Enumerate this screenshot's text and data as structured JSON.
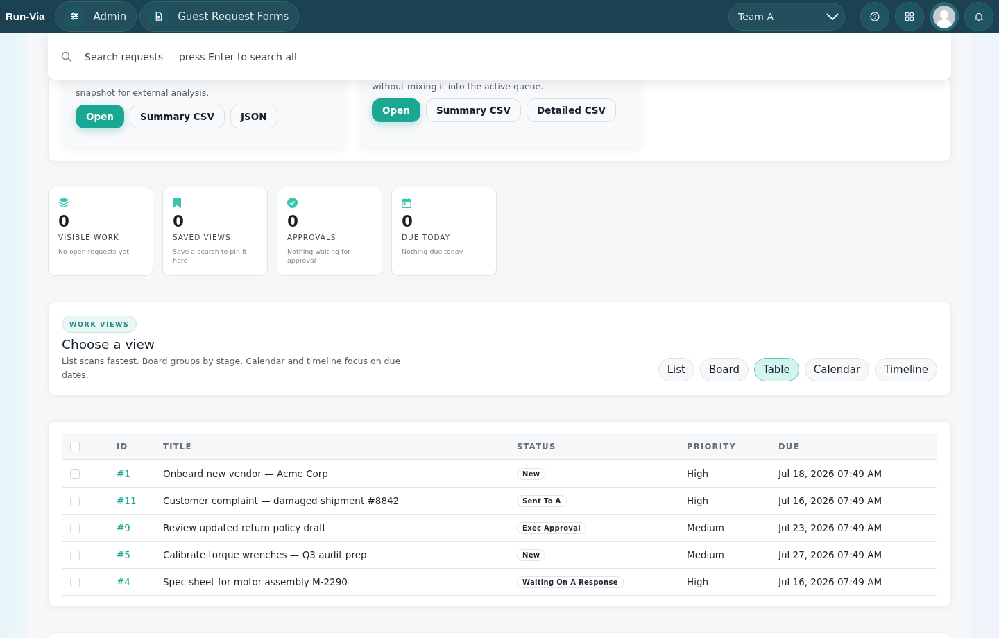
{
  "topbar": {
    "brand": "Run-Via",
    "nav": [
      {
        "label": "Admin"
      },
      {
        "label": "Guest Request Forms"
      }
    ],
    "team": "Team A"
  },
  "search": {
    "placeholder": "Search requests — press Enter to search all"
  },
  "export_cards": [
    {
      "description": "snapshot for external analysis.",
      "buttons": [
        {
          "label": "Open",
          "primary": true
        },
        {
          "label": "Summary CSV",
          "primary": false
        },
        {
          "label": "JSON",
          "primary": false
        }
      ]
    },
    {
      "description": "without mixing it into the active queue.",
      "buttons": [
        {
          "label": "Open",
          "primary": true
        },
        {
          "label": "Summary CSV",
          "primary": false
        },
        {
          "label": "Detailed CSV",
          "primary": false
        }
      ]
    }
  ],
  "stats": [
    {
      "value": "0",
      "label": "VISIBLE WORK",
      "hint": "No open requests yet"
    },
    {
      "value": "0",
      "label": "SAVED VIEWS",
      "hint": "Save a search to pin it here"
    },
    {
      "value": "0",
      "label": "APPROVALS",
      "hint": "Nothing waiting for approval"
    },
    {
      "value": "0",
      "label": "DUE TODAY",
      "hint": "Nothing due today"
    }
  ],
  "work_views": {
    "badge": "WORK VIEWS",
    "title": "Choose a view",
    "description": "List scans fastest. Board groups by stage. Calendar and timeline focus on due dates.",
    "views": [
      {
        "label": "List",
        "selected": false
      },
      {
        "label": "Board",
        "selected": false
      },
      {
        "label": "Table",
        "selected": true
      },
      {
        "label": "Calendar",
        "selected": false
      },
      {
        "label": "Timeline",
        "selected": false
      }
    ]
  },
  "table": {
    "all_checked": false,
    "columns": [
      "ID",
      "TITLE",
      "STATUS",
      "PRIORITY",
      "DUE"
    ],
    "rows": [
      {
        "checked": false,
        "id": "#1",
        "title": "Onboard new vendor — Acme Corp",
        "status": "New",
        "priority": "High",
        "due": "Jul 18, 2026 07:49 AM"
      },
      {
        "checked": false,
        "id": "#11",
        "title": "Customer complaint — damaged shipment #8842",
        "status": "Sent To A",
        "priority": "High",
        "due": "Jul 16, 2026 07:49 AM"
      },
      {
        "checked": false,
        "id": "#9",
        "title": "Review updated return policy draft",
        "status": "Exec Approval",
        "priority": "Medium",
        "due": "Jul 23, 2026 07:49 AM"
      },
      {
        "checked": false,
        "id": "#5",
        "title": "Calibrate torque wrenches — Q3 audit prep",
        "status": "New",
        "priority": "Medium",
        "due": "Jul 27, 2026 07:49 AM"
      },
      {
        "checked": false,
        "id": "#4",
        "title": "Spec sheet for motor assembly M-2290",
        "status": "Waiting On A Response",
        "priority": "High",
        "due": "Jul 16, 2026 07:49 AM"
      }
    ]
  }
}
